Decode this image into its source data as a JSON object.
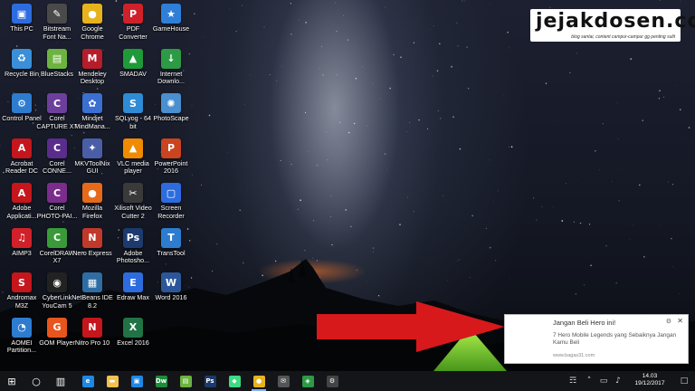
{
  "desktop": {
    "icons": [
      {
        "label": "This PC",
        "color": "#2d6cdf",
        "glyph": "▣"
      },
      {
        "label": "Bitstream Font Na...",
        "color": "#4a4a4a",
        "glyph": "✎"
      },
      {
        "label": "Google Chrome",
        "color": "#e6b31e",
        "glyph": "●"
      },
      {
        "label": "PDF Converter",
        "color": "#d0212a",
        "glyph": "P"
      },
      {
        "label": "GameHouse",
        "color": "#2f7fd8",
        "glyph": "★"
      },
      {
        "label": "Recycle Bin",
        "color": "#3a8fd8",
        "glyph": "♻"
      },
      {
        "label": "BlueStacks",
        "color": "#6cb33f",
        "glyph": "▤"
      },
      {
        "label": "Mendeley Desktop",
        "color": "#b51d2b",
        "glyph": "M"
      },
      {
        "label": "SMADAV",
        "color": "#1f9a3a",
        "glyph": "▲"
      },
      {
        "label": "Internet Downlo...",
        "color": "#2d9a45",
        "glyph": "↓"
      },
      {
        "label": "Control Panel",
        "color": "#2d7cd0",
        "glyph": "⚙"
      },
      {
        "label": "Corel CAPTURE X7",
        "color": "#6d3f9c",
        "glyph": "C"
      },
      {
        "label": "Mindjet MindMana...",
        "color": "#3b6fd1",
        "glyph": "✿"
      },
      {
        "label": "SQLyog - 64 bit",
        "color": "#2e8bd6",
        "glyph": "S"
      },
      {
        "label": "PhotoScape",
        "color": "#4a8fd0",
        "glyph": "✺"
      },
      {
        "label": "Acrobat Reader DC",
        "color": "#c4161c",
        "glyph": "A"
      },
      {
        "label": "Corel CONNE...",
        "color": "#5a2d8c",
        "glyph": "C"
      },
      {
        "label": "MKVToolNix GUI",
        "color": "#4a5ea8",
        "glyph": "✦"
      },
      {
        "label": "VLC media player",
        "color": "#f08a00",
        "glyph": "▲"
      },
      {
        "label": "PowerPoint 2016",
        "color": "#c9441f",
        "glyph": "P"
      },
      {
        "label": "Adobe Applicati...",
        "color": "#c4161c",
        "glyph": "A"
      },
      {
        "label": "Corel PHOTO-PAI...",
        "color": "#7b2d8c",
        "glyph": "C"
      },
      {
        "label": "Mozilla Firefox",
        "color": "#e66a1a",
        "glyph": "●"
      },
      {
        "label": "Xilisoft Video Cutter 2",
        "color": "#3a3a3a",
        "glyph": "✂"
      },
      {
        "label": "Screen Recorder",
        "color": "#2d6cdf",
        "glyph": "▢"
      },
      {
        "label": "AIMP3",
        "color": "#d0212a",
        "glyph": "♫"
      },
      {
        "label": "CorelDRAW X7",
        "color": "#3a9a3a",
        "glyph": "C"
      },
      {
        "label": "Nero Express",
        "color": "#c0392b",
        "glyph": "N"
      },
      {
        "label": "Adobe Photosho...",
        "color": "#1c3a6e",
        "glyph": "Ps"
      },
      {
        "label": "TransTool",
        "color": "#2d7cd0",
        "glyph": "T"
      },
      {
        "label": "Andromax M3Z",
        "color": "#c4161c",
        "glyph": "S"
      },
      {
        "label": "CyberLink YouCam 5",
        "color": "#222",
        "glyph": "◉"
      },
      {
        "label": "NetBeans IDE 8.2",
        "color": "#2e6da4",
        "glyph": "▦"
      },
      {
        "label": "Edraw Max",
        "color": "#2d6cdf",
        "glyph": "E"
      },
      {
        "label": "Word 2016",
        "color": "#2b579a",
        "glyph": "W"
      },
      {
        "label": "AOMEI Partition...",
        "color": "#2d7cd0",
        "glyph": "◔"
      },
      {
        "label": "GOM Player",
        "color": "#e8551d",
        "glyph": "G"
      },
      {
        "label": "Nitro Pro 10",
        "color": "#c4161c",
        "glyph": "N"
      },
      {
        "label": "Excel 2016",
        "color": "#217346",
        "glyph": "X"
      }
    ]
  },
  "logo": {
    "text": "jejakdosen.com",
    "tagline": "blog santai, content campur-campur gg penting sulit"
  },
  "annotation_arrow": {
    "color": "#d7191c"
  },
  "notification": {
    "title": "Jangan Beli Hero ini!",
    "body": "7 Hero Mobile Legends yang Sebaiknya Jangan Kamu Beli",
    "source": "www.bagas31.com",
    "settings_icon": "gear-icon",
    "close_icon": "close-icon",
    "settings_glyph": "⚙",
    "close_glyph": "✕"
  },
  "taskbar": {
    "start_glyph": "⊞",
    "search_glyph": "○",
    "taskview_glyph": "▥",
    "apps": [
      {
        "name": "edge",
        "glyph": "e",
        "color": "#1e88e5"
      },
      {
        "name": "file-explorer",
        "glyph": "▬",
        "color": "#f2c14e"
      },
      {
        "name": "store",
        "glyph": "▣",
        "color": "#1e88e5"
      },
      {
        "name": "dreamweaver",
        "glyph": "Dw",
        "color": "#1e8c3a"
      },
      {
        "name": "bluestacks",
        "glyph": "▤",
        "color": "#6cb33f"
      },
      {
        "name": "photoshop",
        "glyph": "Ps",
        "color": "#1c3a6e"
      },
      {
        "name": "android",
        "glyph": "◆",
        "color": "#3ddc84"
      },
      {
        "name": "chrome",
        "glyph": "●",
        "color": "#e6b31e"
      },
      {
        "name": "mail",
        "glyph": "✉",
        "color": "#555"
      },
      {
        "name": "network-tool",
        "glyph": "◈",
        "color": "#2d9a45"
      },
      {
        "name": "settings",
        "glyph": "⚙",
        "color": "#444"
      }
    ],
    "tray": {
      "people_glyph": "☶",
      "chevron_glyph": "˄",
      "network_glyph": "▭",
      "volume_glyph": "♪",
      "notification_glyph": "□",
      "time": "14.03",
      "date": "19/12/2017"
    }
  }
}
